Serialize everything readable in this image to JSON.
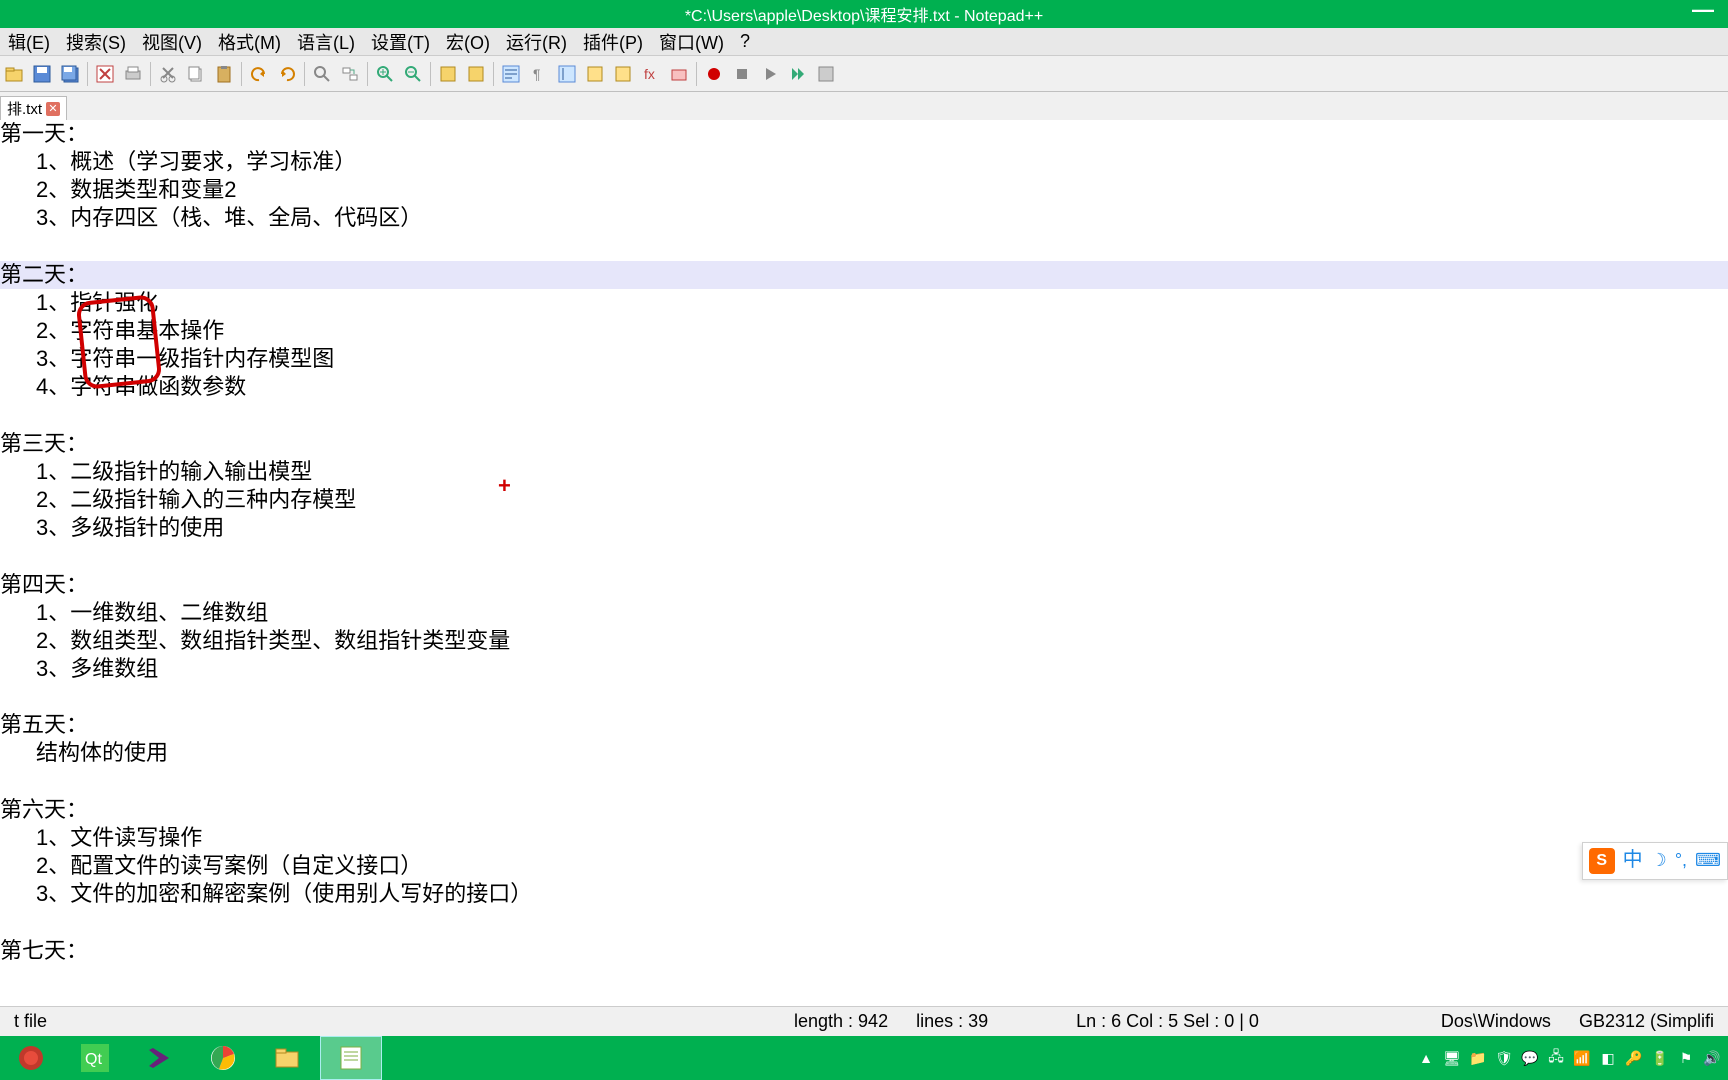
{
  "title": "*C:\\Users\\apple\\Desktop\\课程安排.txt - Notepad++",
  "menus": [
    "辑(E)",
    "搜索(S)",
    "视图(V)",
    "格式(M)",
    "语言(L)",
    "设置(T)",
    "宏(O)",
    "运行(R)",
    "插件(P)",
    "窗口(W)",
    "?"
  ],
  "tab": {
    "label": "排.txt"
  },
  "lines": [
    {
      "t": "第一天：",
      "cls": ""
    },
    {
      "t": "1、概述（学习要求，学习标准）",
      "cls": "indent"
    },
    {
      "t": "2、数据类型和变量2",
      "cls": "indent"
    },
    {
      "t": "3、内存四区（栈、堆、全局、代码区）",
      "cls": "indent"
    },
    {
      "t": " ",
      "cls": ""
    },
    {
      "t": "第二天：",
      "cls": "hl"
    },
    {
      "t": "1、指针强化",
      "cls": "indent"
    },
    {
      "t": "2、字符串基本操作",
      "cls": "indent"
    },
    {
      "t": "3、字符串一级指针内存模型图",
      "cls": "indent"
    },
    {
      "t": "4、字符串做函数参数",
      "cls": "indent"
    },
    {
      "t": " ",
      "cls": ""
    },
    {
      "t": "第三天：",
      "cls": ""
    },
    {
      "t": "1、二级指针的输入输出模型",
      "cls": "indent"
    },
    {
      "t": "2、二级指针输入的三种内存模型",
      "cls": "indent"
    },
    {
      "t": "3、多级指针的使用",
      "cls": "indent"
    },
    {
      "t": " ",
      "cls": ""
    },
    {
      "t": "第四天：",
      "cls": ""
    },
    {
      "t": "1、一维数组、二维数组",
      "cls": "indent"
    },
    {
      "t": "2、数组类型、数组指针类型、数组指针类型变量",
      "cls": "indent"
    },
    {
      "t": "3、多维数组",
      "cls": "indent"
    },
    {
      "t": " ",
      "cls": ""
    },
    {
      "t": "第五天：",
      "cls": ""
    },
    {
      "t": "结构体的使用",
      "cls": "indent"
    },
    {
      "t": " ",
      "cls": ""
    },
    {
      "t": "第六天：",
      "cls": ""
    },
    {
      "t": "1、文件读写操作",
      "cls": "indent"
    },
    {
      "t": "2、配置文件的读写案例（自定义接口）",
      "cls": "indent"
    },
    {
      "t": "3、文件的加密和解密案例（使用别人写好的接口）",
      "cls": "indent"
    },
    {
      "t": " ",
      "cls": ""
    },
    {
      "t": "第七天：",
      "cls": ""
    }
  ],
  "status": {
    "type": "t file",
    "length": "length : 942",
    "lines": "lines : 39",
    "pos": "Ln : 6    Col : 5    Sel : 0 | 0",
    "eol": "Dos\\Windows",
    "enc": "GB2312 (Simplifi"
  },
  "ime": {
    "logo": "S",
    "mode": "中"
  },
  "plus": "+"
}
